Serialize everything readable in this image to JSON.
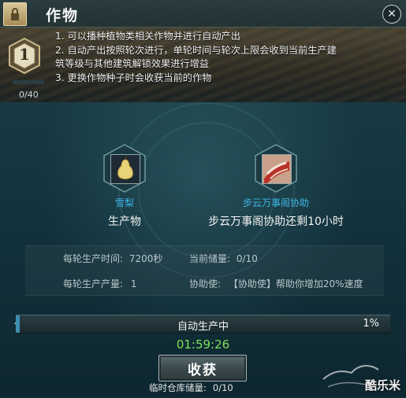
{
  "window": {
    "title": "作物"
  },
  "level": {
    "number": "1",
    "progress_text": "0/40",
    "progress_fraction": 0.0
  },
  "rules": [
    "1. 可以播种植物类相关作物并进行自动产出",
    "2. 自动产出按照轮次进行，单轮时间与轮次上限会收到当前生产建",
    "筑等级与其他建筑解锁效果进行增益",
    "3. 更换作物种子时会收获当前的作物"
  ],
  "product": {
    "item_name": "雪梨",
    "label": "生产物",
    "name_color": "#3fb6e8"
  },
  "assist": {
    "item_name": "步云万事阁协助",
    "label": "步云万事阁协助还剩10小时",
    "name_color": "#3fb6e8"
  },
  "stats": {
    "round_time_label": "每轮生产时间:",
    "round_time_value": "7200秒",
    "storage_label": "当前储量:",
    "storage_value": "0/10",
    "round_output_label": "每轮生产产量:",
    "round_output_value": "1",
    "assistant_label": "协助使:",
    "assistant_value": "【协助使】帮助你增加20%速度"
  },
  "production": {
    "status": "自动生产中",
    "percent_text": "1%",
    "percent": 1,
    "timer": "01:59:26"
  },
  "harvest": {
    "button_label": "收获"
  },
  "temp_storage": {
    "label": "临时仓库储量:",
    "value": "0/10"
  },
  "watermark": {
    "text": "酷乐米"
  },
  "colors": {
    "accent_blue": "#3fb6e8",
    "timer_green": "#7ee05a",
    "panel_bg": "#12303a"
  }
}
